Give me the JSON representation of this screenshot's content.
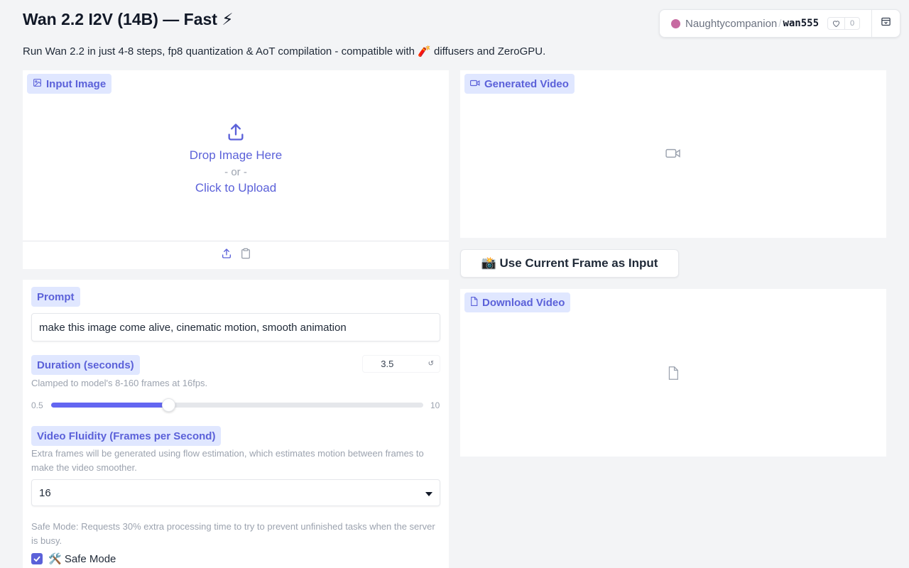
{
  "header": {
    "title": "Wan 2.2 I2V (14B) — Fast ⚡",
    "subtitle": "Run Wan 2.2 in just 4-8 steps, fp8 quantization & AoT compilation - compatible with 🧨 diffusers and ZeroGPU."
  },
  "space_badge": {
    "owner": "Naughtycompanion",
    "separator": "/",
    "name": "wan555",
    "likes": "0",
    "dot_color": "#c76aa1"
  },
  "input_image": {
    "label": "Input Image",
    "drop_title": "Drop Image Here",
    "drop_or": "- or -",
    "drop_click": "Click to Upload"
  },
  "prompt": {
    "label": "Prompt",
    "value": "make this image come alive, cinematic motion, smooth animation"
  },
  "duration": {
    "label": "Duration (seconds)",
    "value": "3.5",
    "info": "Clamped to model's 8-160 frames at 16fps.",
    "min": "0.5",
    "max": "10",
    "fraction": 0.3158
  },
  "fluidity": {
    "label": "Video Fluidity (Frames per Second)",
    "info": "Extra frames will be generated using flow estimation, which estimates motion between frames to make the video smoother.",
    "selected": "16"
  },
  "safe_mode": {
    "info": "Safe Mode: Requests 30% extra processing time to try to prevent unfinished tasks when the server is busy.",
    "label": "🛠️ Safe Mode",
    "checked": true
  },
  "generated_video": {
    "label": "Generated Video"
  },
  "use_frame_button": {
    "label": "📸 Use Current Frame as Input"
  },
  "download_video": {
    "label": "Download Video"
  },
  "colors": {
    "accent": "#5b61d9",
    "chip_bg": "#e0e7ff",
    "slider_fill": "#6366f1"
  }
}
